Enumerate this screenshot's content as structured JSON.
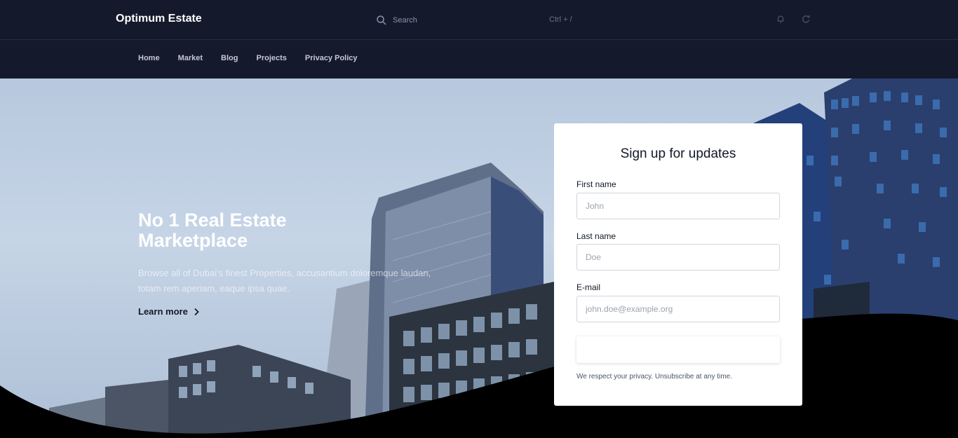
{
  "header": {
    "brand": "Optimum Estate",
    "search": {
      "placeholder": "Search",
      "shortcut": "Ctrl + /"
    },
    "icons": [
      "search-icon",
      "bell-icon",
      "refresh-icon"
    ]
  },
  "nav": {
    "items": [
      {
        "label": "Home"
      },
      {
        "label": "Market"
      },
      {
        "label": "Blog"
      },
      {
        "label": "Projects"
      },
      {
        "label": "Privacy Policy"
      }
    ]
  },
  "hero": {
    "title": "No 1 Real Estate Marketplace",
    "subtitle": "Browse all of Dubai's finest Properties, accusantium doloremque laudan, totam rem aperiam, eaque ipsa quae.",
    "cta_label": "Learn more"
  },
  "signup": {
    "title": "Sign up for updates",
    "first_name_label": "First name",
    "first_name_placeholder": "John",
    "last_name_label": "Last name",
    "last_name_placeholder": "Doe",
    "email_label": "E-mail",
    "email_placeholder": "john.doe@example.org",
    "submit_label": "",
    "privacy_note": "We respect your privacy. Unsubscribe at any time."
  },
  "colors": {
    "header_bg": "#141a2b",
    "card_bg": "#ffffff",
    "accent_text": "#111827"
  }
}
